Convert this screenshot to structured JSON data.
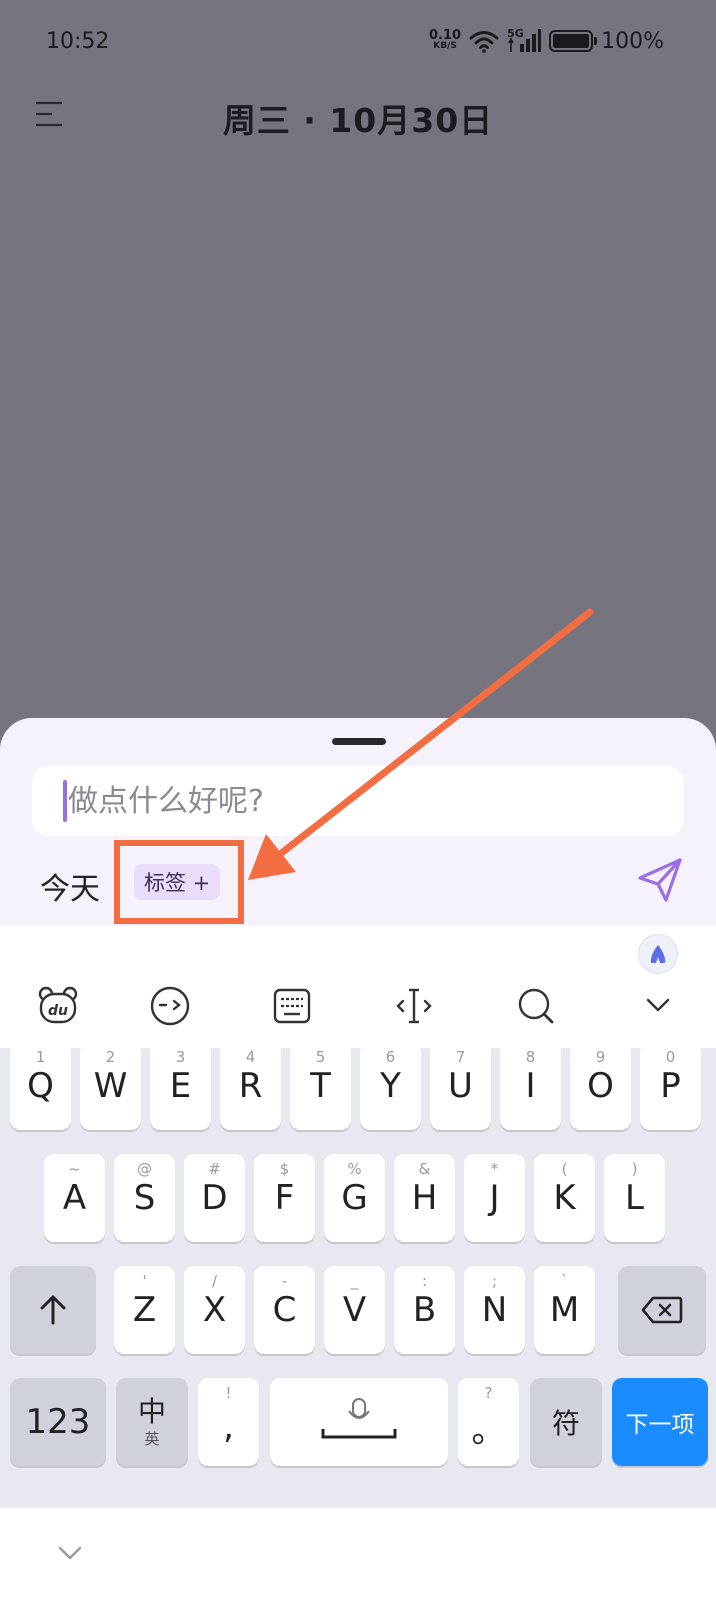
{
  "status_bar": {
    "time": "10:52",
    "net_speed_value": "0.10",
    "net_speed_unit": "KB/S",
    "network_type": "5G",
    "battery_percent": "100%"
  },
  "header": {
    "title": "周三 · 10月30日"
  },
  "sheet": {
    "input_placeholder": "做点什么好呢?",
    "input_value": "",
    "date_label": "今天",
    "tag_label": "标签 +"
  },
  "annotation": {
    "color": "#f26d42"
  },
  "keyboard": {
    "row1": [
      {
        "main": "Q",
        "sub": "1"
      },
      {
        "main": "W",
        "sub": "2"
      },
      {
        "main": "E",
        "sub": "3"
      },
      {
        "main": "R",
        "sub": "4"
      },
      {
        "main": "T",
        "sub": "5"
      },
      {
        "main": "Y",
        "sub": "6"
      },
      {
        "main": "U",
        "sub": "7"
      },
      {
        "main": "I",
        "sub": "8"
      },
      {
        "main": "O",
        "sub": "9"
      },
      {
        "main": "P",
        "sub": "0"
      }
    ],
    "row2": [
      {
        "main": "A",
        "sub": "~"
      },
      {
        "main": "S",
        "sub": "@"
      },
      {
        "main": "D",
        "sub": "#"
      },
      {
        "main": "F",
        "sub": "$"
      },
      {
        "main": "G",
        "sub": "%"
      },
      {
        "main": "H",
        "sub": "&"
      },
      {
        "main": "J",
        "sub": "*"
      },
      {
        "main": "K",
        "sub": "("
      },
      {
        "main": "L",
        "sub": ")"
      }
    ],
    "row3": [
      {
        "main": "Z",
        "sub": "'"
      },
      {
        "main": "X",
        "sub": "/"
      },
      {
        "main": "C",
        "sub": "-"
      },
      {
        "main": "V",
        "sub": "_"
      },
      {
        "main": "B",
        "sub": ":"
      },
      {
        "main": "N",
        "sub": ";"
      },
      {
        "main": "M",
        "sub": "`"
      }
    ],
    "numbers_key": "123",
    "lang_key_main": "中",
    "lang_key_sub": "英",
    "comma_key_main": ",",
    "comma_key_sub": "!",
    "period_key_main": "。",
    "period_key_sub": "?",
    "symbols_key": "符",
    "next_key": "下一项",
    "accent_color": "#1a8cff"
  }
}
